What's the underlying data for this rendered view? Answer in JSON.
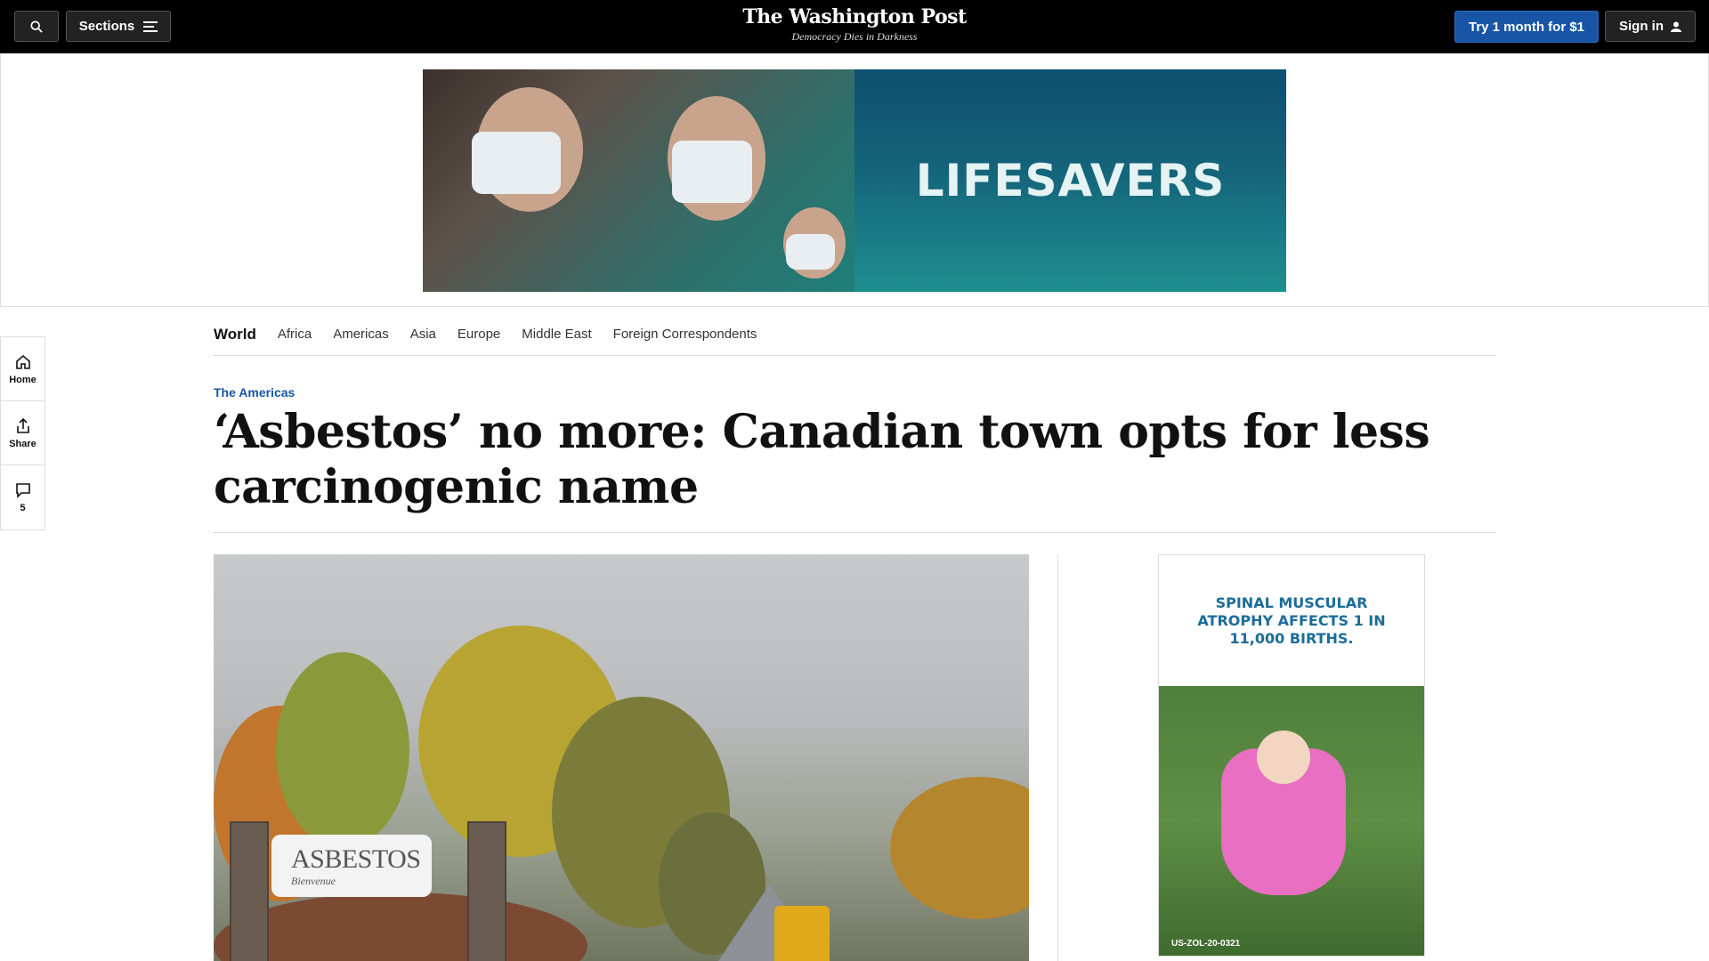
{
  "topbar": {
    "sections_label": "Sections",
    "logo_name": "The Washington Post",
    "logo_tagline": "Democracy Dies in Darkness",
    "try_label": "Try 1 month for $1",
    "signin_label": "Sign in"
  },
  "ad_banner": {
    "text": "LIFESAVERS"
  },
  "rail": {
    "home_label": "Home",
    "share_label": "Share",
    "comments_count": "5"
  },
  "section_nav": {
    "current": "World",
    "items": [
      "Africa",
      "Americas",
      "Asia",
      "Europe",
      "Middle East",
      "Foreign Correspondents"
    ]
  },
  "article": {
    "kicker": "The Americas",
    "headline": "‘Asbestos’ no more: Canadian town opts for less carcinogenic name"
  },
  "lead_image": {
    "sign_text": "ASBESTOS",
    "sign_subtext": "Bienvenue"
  },
  "side_ad": {
    "title": "SPINAL MUSCULAR ATROPHY AFFECTS 1 IN 11,000 BIRTHS.",
    "code": "US-ZOL-20-0321"
  },
  "colors": {
    "brand_blue": "#1955a5",
    "topbar_bg": "#000000"
  }
}
